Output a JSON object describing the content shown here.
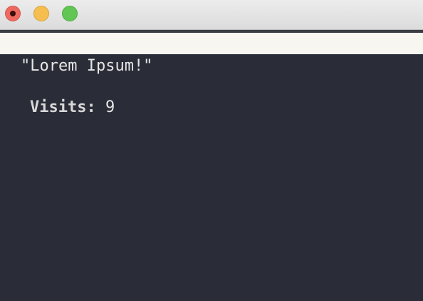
{
  "window": {
    "controls": {
      "close_icon": "close-icon",
      "minimize_icon": "minimize-icon",
      "maximize_icon": "maximize-icon"
    }
  },
  "content": {
    "message": "\"Lorem Ipsum!\"",
    "visits_label": "Visits:",
    "visits_value": "9"
  },
  "colors": {
    "background": "#2a2c37",
    "cream_bar": "#f7f6f0",
    "close": "#ee6a5f",
    "minimize": "#f5be4f",
    "maximize": "#62c655"
  }
}
